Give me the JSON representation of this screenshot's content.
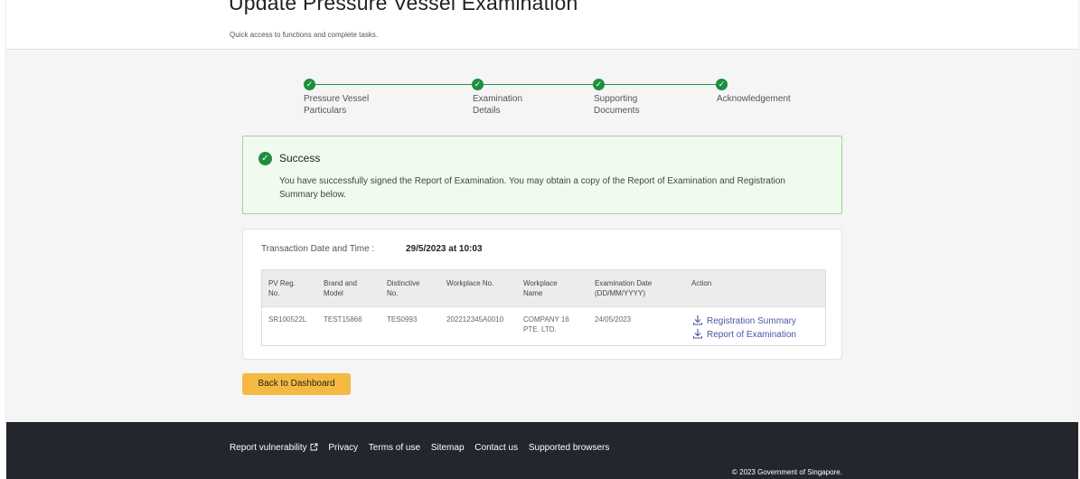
{
  "header": {
    "title": "Update Pressure Vessel Examination",
    "subtitle": "Quick access to functions and complete tasks."
  },
  "stepper": {
    "steps": [
      {
        "label": "Pressure Vessel\nParticulars",
        "status": "completed"
      },
      {
        "label": "Examination\nDetails",
        "status": "completed"
      },
      {
        "label": "Supporting\nDocuments",
        "status": "completed"
      },
      {
        "label": "Acknowledgement",
        "status": "completed"
      }
    ],
    "icon": "check-icon",
    "color": "#1e8e3e"
  },
  "alert": {
    "title": "Success",
    "message": "You have successfully signed the Report of Examination. You may obtain a copy of the Report of Examination and Registration Summary below.",
    "icon": "check-circle-icon",
    "color": "#1e8e3e"
  },
  "transaction": {
    "label": "Transaction Date and Time :",
    "value": "29/5/2023 at 10:03"
  },
  "table": {
    "headers": [
      "PV Reg.\nNo.",
      "Brand and\nModel",
      "Distinctive\nNo.",
      "Workplace No.",
      "Workplace\nName",
      "Examination Date\n(DD/MM/YYYY)",
      "Action"
    ],
    "rows": [
      {
        "pv_reg_no": "SR100522L",
        "brand_model": "TEST15866",
        "distinctive_no": "TES0993",
        "workplace_no": "202212345A0010",
        "workplace_name": "COMPANY 16\nPTE. LTD.",
        "exam_date": "24/05/2023",
        "actions": [
          {
            "label": "Registration Summary",
            "icon": "download-icon"
          },
          {
            "label": "Report of Examination",
            "icon": "download-icon"
          }
        ]
      }
    ]
  },
  "buttons": {
    "back_label": "Back to Dashboard",
    "back_color": "#f5b942"
  },
  "footer": {
    "links": [
      {
        "label": "Report vulnerability",
        "icon": "external-link-icon"
      },
      {
        "label": "Privacy"
      },
      {
        "label": "Terms of use"
      },
      {
        "label": "Sitemap"
      },
      {
        "label": "Contact us"
      },
      {
        "label": "Supported browsers"
      }
    ],
    "copyright": "© 2023 Government of Singapore."
  }
}
